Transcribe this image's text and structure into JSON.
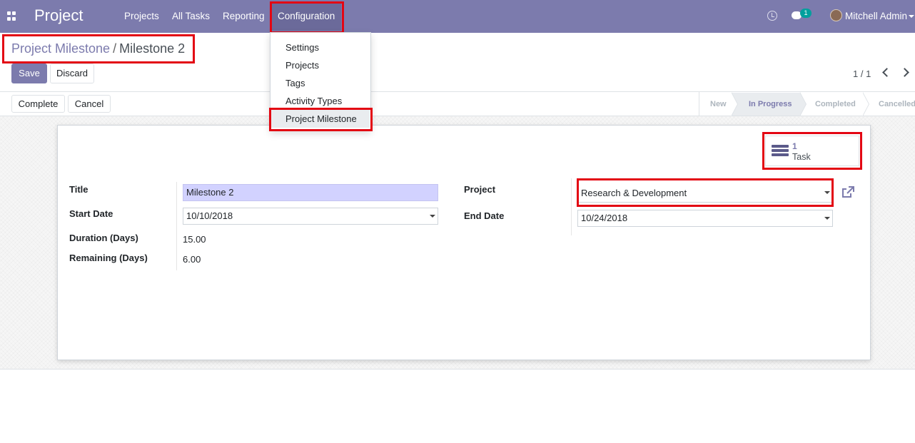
{
  "app": {
    "title": "Project"
  },
  "navbar": {
    "menu": [
      "Projects",
      "All Tasks",
      "Reporting",
      "Configuration"
    ],
    "chat_count": "1",
    "user_name": "Mitchell Admin"
  },
  "dropdown": {
    "items": [
      "Settings",
      "Projects",
      "Tags",
      "Activity Types",
      "Project Milestone"
    ],
    "selected": "Project Milestone"
  },
  "breadcrumb": {
    "parent": "Project Milestone",
    "separator": "/",
    "current": "Milestone 2"
  },
  "buttons": {
    "save": "Save",
    "discard": "Discard",
    "complete": "Complete",
    "cancel": "Cancel"
  },
  "pager": {
    "value": "1 / 1"
  },
  "stages": [
    {
      "label": "New",
      "active": false
    },
    {
      "label": "In Progress",
      "active": true
    },
    {
      "label": "Completed",
      "active": false
    },
    {
      "label": "Cancelled",
      "active": false
    }
  ],
  "smart_button": {
    "count": "1",
    "label": "Task"
  },
  "form": {
    "title": {
      "label": "Title",
      "value": "Milestone 2"
    },
    "start_date": {
      "label": "Start Date",
      "value": "10/10/2018"
    },
    "duration": {
      "label": "Duration (Days)",
      "value": "15.00"
    },
    "remaining": {
      "label": "Remaining (Days)",
      "value": "6.00"
    },
    "project": {
      "label": "Project",
      "value": "Research & Development"
    },
    "end_date": {
      "label": "End Date",
      "value": "10/24/2018"
    }
  },
  "colors": {
    "brand": "#7C7BAD",
    "highlight": "#e30613"
  }
}
